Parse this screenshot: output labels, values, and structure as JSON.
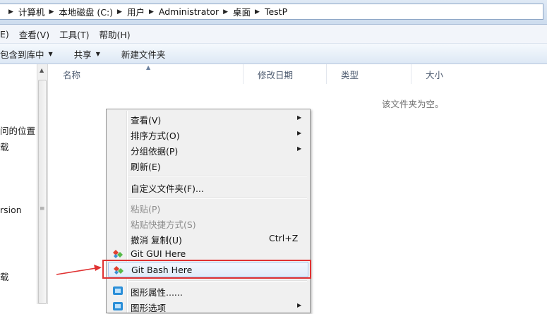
{
  "breadcrumb": {
    "items": [
      "计算机",
      "本地磁盘 (C:)",
      "用户",
      "Administrator",
      "桌面",
      "TestP"
    ]
  },
  "menubar": {
    "items": [
      "E)",
      "查看(V)",
      "工具(T)",
      "帮助(H)"
    ]
  },
  "toolbar": {
    "include_library": "包含到库中",
    "share": "共享",
    "new_folder": "新建文件夹"
  },
  "navpane": {
    "items": [
      "问的位置",
      "载",
      "rsion",
      "载"
    ]
  },
  "filelist": {
    "columns": [
      "名称",
      "修改日期",
      "类型",
      "大小"
    ],
    "empty_message": "该文件夹为空。"
  },
  "context_menu": {
    "view": "查看(V)",
    "sort_by": "排序方式(O)",
    "group_by": "分组依据(P)",
    "refresh": "刷新(E)",
    "customize_folder": "自定义文件夹(F)...",
    "paste": "粘贴(P)",
    "paste_shortcut": "粘贴快捷方式(S)",
    "undo_copy": "撤消 复制(U)",
    "undo_shortcut": "Ctrl+Z",
    "git_gui": "Git GUI Here",
    "git_bash": "Git Bash Here",
    "graphics_properties": "图形属性......",
    "graphics_options": "图形选项"
  },
  "colors": {
    "annotation_red": "#e03232",
    "git_red": "#e0402f",
    "git_green": "#56b948",
    "git_blue": "#3a8fd4"
  }
}
